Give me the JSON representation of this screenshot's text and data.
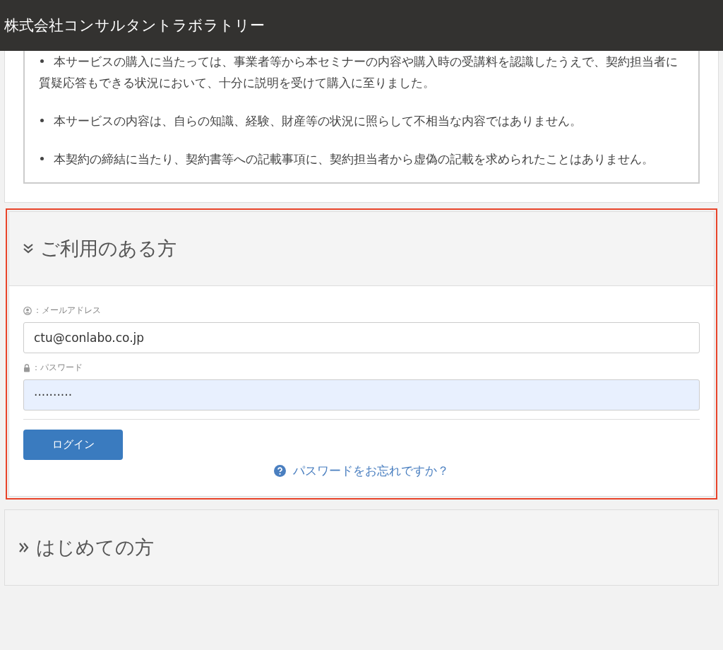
{
  "header": {
    "title": "株式会社コンサルタントラボラトリー"
  },
  "confirmations": [
    "本サービスの購入に当たっては、事業者等から本セミナーの内容や購入時の受講料を認識したうえで、契約担当者に質疑応答もできる状況において、十分に説明を受けて購入に至りました。",
    "本サービスの内容は、自らの知識、経験、財産等の状況に照らして不相当な内容ではありません。",
    "本契約の締結に当たり、契約書等への記載事項に、契約担当者から虚偽の記載を求められたことはありません。"
  ],
  "login_section": {
    "title": "ご利用のある方",
    "expanded": true,
    "highlighted": true,
    "fields": [
      {
        "kind": "email",
        "label": "：メールアドレス",
        "value": "ctu@conlabo.co.jp",
        "autofilled": false
      },
      {
        "kind": "password",
        "label": "：パスワード",
        "value": "··········",
        "autofilled": true
      }
    ],
    "login_button": "ログイン",
    "forgot_link": "パスワードをお忘れですか？"
  },
  "first_time_section": {
    "title": "はじめての方",
    "expanded": false
  }
}
